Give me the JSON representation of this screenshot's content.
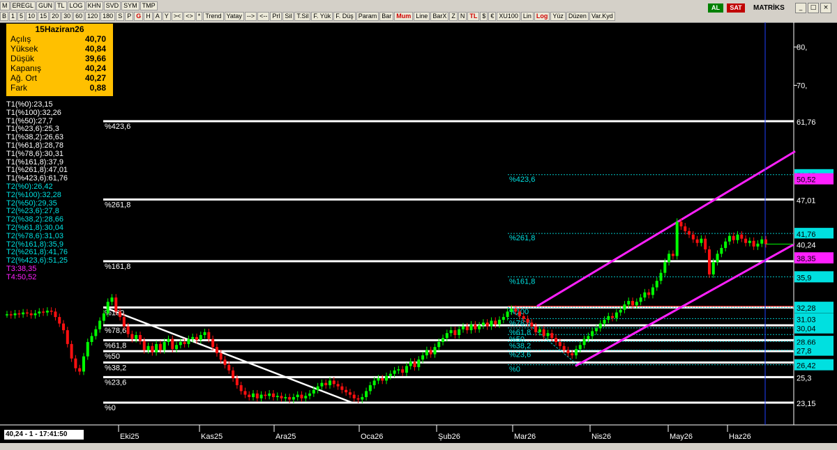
{
  "toolbar": {
    "row1": [
      "M",
      "EREGL",
      "GUN",
      "TL",
      "LOG",
      "KHN",
      "SVD",
      "SYM",
      "TMP"
    ],
    "row2": [
      "B",
      "1",
      "5",
      "10",
      "15",
      "20",
      "30",
      "60",
      "120",
      "180",
      "S",
      "P",
      "G",
      "H",
      "A",
      "Y",
      "><",
      "<>",
      "*",
      "Trend",
      "Yatay",
      "-->",
      "<--",
      "Prl",
      "Sil",
      "T.Sil",
      "F. Yük",
      "F. Düş",
      "Param",
      "Bar",
      "Mum",
      "Line",
      "BarX",
      "Z",
      "N",
      "TL",
      "$",
      "€",
      "XU100",
      "Lin",
      "Log",
      "Yüz",
      "Düzen",
      "Var.Kyd"
    ],
    "al": "AL",
    "sat": "SAT",
    "brand": "MATRİKS"
  },
  "info": {
    "date": "15Haziran26",
    "rows": [
      {
        "k": "Açılış",
        "v": "40,70"
      },
      {
        "k": "Yüksek",
        "v": "40,84"
      },
      {
        "k": "Düşük",
        "v": "39,66"
      },
      {
        "k": "Kapanış",
        "v": "40,24"
      },
      {
        "k": "Ağ. Ort",
        "v": "40,27"
      },
      {
        "k": "Fark",
        "v": "0,88"
      }
    ]
  },
  "levels": [
    {
      "t": "T1(%0):23,15",
      "c": "#ffffff"
    },
    {
      "t": "T1(%100):32,26",
      "c": "#ffffff"
    },
    {
      "t": "T1(%50):27,7",
      "c": "#ffffff"
    },
    {
      "t": "T1(%23,6):25,3",
      "c": "#ffffff"
    },
    {
      "t": "T1(%38,2):26,63",
      "c": "#ffffff"
    },
    {
      "t": "T1(%61,8):28,78",
      "c": "#ffffff"
    },
    {
      "t": "T1(%78,6):30,31",
      "c": "#ffffff"
    },
    {
      "t": "T1(%161,8):37,9",
      "c": "#ffffff"
    },
    {
      "t": "T1(%261,8):47,01",
      "c": "#ffffff"
    },
    {
      "t": "T1(%423,6):61,76",
      "c": "#ffffff"
    },
    {
      "t": "T2(%0):26,42",
      "c": "#00e0e0"
    },
    {
      "t": "T2(%100):32,28",
      "c": "#00e0e0"
    },
    {
      "t": "T2(%50):29,35",
      "c": "#00e0e0"
    },
    {
      "t": "T2(%23,6):27,8",
      "c": "#00e0e0"
    },
    {
      "t": "T2(%38,2):28,66",
      "c": "#00e0e0"
    },
    {
      "t": "T2(%61,8):30,04",
      "c": "#00e0e0"
    },
    {
      "t": "T2(%78,6):31,03",
      "c": "#00e0e0"
    },
    {
      "t": "T2(%161,8):35,9",
      "c": "#00e0e0"
    },
    {
      "t": "T2(%261,8):41,76",
      "c": "#00e0e0"
    },
    {
      "t": "T2(%423,6):51,25",
      "c": "#00e0e0"
    },
    {
      "t": "T3:38,35",
      "c": "#ff20ff"
    },
    {
      "t": "T4:50,52",
      "c": "#ff20ff"
    }
  ],
  "status": "40,24 - 1 - 17:41:50",
  "chart_data": {
    "type": "candlestick",
    "y_scale": "log",
    "y_ticks": [
      80,
      70
    ],
    "months": [
      "Eki25",
      "Kas25",
      "Ara25",
      "Oca26",
      "Şub26",
      "Mar26",
      "Nis26",
      "May26",
      "Haz26"
    ],
    "fib_t1": [
      {
        "label": "%423,6",
        "value": 61.76,
        "tag": "61,76"
      },
      {
        "label": "%261,8",
        "value": 47.01,
        "tag": "47,01"
      },
      {
        "label": "%161,8",
        "value": 37.9,
        "tag": ""
      },
      {
        "label": "%100",
        "value": 32.26,
        "tag": "32,28"
      },
      {
        "label": "%78,6",
        "value": 30.31,
        "tag": "31,03"
      },
      {
        "label": "%61,8",
        "value": 28.78,
        "tag": ""
      },
      {
        "label": "%50",
        "value": 27.7,
        "tag": ""
      },
      {
        "label": "%38,2",
        "value": 26.63,
        "tag": ""
      },
      {
        "label": "%23,6",
        "value": 25.3,
        "tag": "25,3"
      },
      {
        "label": "%0",
        "value": 23.15,
        "tag": "23,15"
      }
    ],
    "fib_t2": [
      {
        "label": "%423,6",
        "value": 51.25
      },
      {
        "label": "%261,8",
        "value": 41.76
      },
      {
        "label": "%161,8",
        "value": 35.9
      },
      {
        "label": "%100",
        "value": 32.28
      },
      {
        "label": "%78,6",
        "value": 31.03
      },
      {
        "label": "%61,8",
        "value": 30.04
      },
      {
        "label": "%50",
        "value": 29.35
      },
      {
        "label": "%38,2",
        "value": 28.66
      },
      {
        "label": "%23,6",
        "value": 27.8
      },
      {
        "label": "%0",
        "value": 26.42
      }
    ],
    "tags": {
      "t2_top": "51,25",
      "t4": "50,52",
      "t2_261": "41,76",
      "last": "40,24",
      "t3": "38,35",
      "t2_161": "35,9",
      "t2_100": "32,28",
      "t2_786": "31,03",
      "t2_618": "30,04",
      "t2_382": "28,66",
      "t2_236": "27,8",
      "t2_0": "26,42"
    },
    "closes": [
      31.5,
      31.4,
      31.6,
      31.5,
      31.7,
      31.6,
      31.4,
      31.6,
      31.8,
      31.7,
      31.9,
      31.8,
      31.2,
      30.5,
      29.8,
      28.4,
      27.0,
      26.1,
      25.8,
      27.2,
      28.6,
      29.2,
      29.9,
      30.8,
      31.6,
      32.9,
      33.4,
      31.8,
      31.2,
      30.2,
      29.4,
      28.9,
      29.3,
      28.7,
      27.8,
      28.2,
      27.6,
      28.4,
      27.8,
      28.6,
      28.9,
      27.9,
      28.3,
      28.6,
      28.4,
      28.9,
      29.1,
      28.8,
      29.3,
      29.6,
      28.9,
      28.1,
      27.5,
      26.9,
      26.4,
      25.9,
      25.2,
      24.6,
      24.1,
      23.8,
      23.6,
      23.9,
      23.5,
      23.8,
      23.7,
      23.9,
      23.6,
      23.7,
      23.5,
      23.6,
      23.4,
      23.6,
      23.8,
      23.5,
      23.7,
      23.9,
      24.2,
      24.5,
      24.8,
      24.6,
      25.0,
      24.7,
      24.5,
      24.2,
      24.0,
      23.8,
      23.5,
      23.4,
      23.6,
      24.1,
      24.6,
      25.0,
      25.2,
      25.0,
      25.4,
      25.6,
      25.9,
      26.0,
      25.7,
      26.3,
      26.7,
      26.2,
      26.9,
      27.3,
      27.8,
      27.4,
      28.1,
      28.6,
      29.0,
      29.5,
      29.8,
      29.3,
      29.9,
      30.2,
      29.8,
      30.4,
      29.9,
      30.3,
      30.6,
      30.2,
      30.8,
      30.4,
      30.9,
      31.2,
      31.8,
      32.1,
      31.8,
      31.3,
      31.0,
      30.6,
      30.2,
      29.6,
      29.9,
      29.2,
      29.5,
      29.0,
      28.6,
      28.2,
      27.8,
      27.5,
      27.3,
      27.9,
      28.3,
      28.9,
      29.2,
      29.7,
      30.0,
      30.5,
      30.9,
      31.3,
      31.1,
      31.7,
      32.0,
      32.6,
      33.0,
      32.5,
      32.9,
      33.4,
      34.0,
      33.7,
      34.6,
      35.4,
      36.4,
      37.8,
      38.9,
      38.6,
      43.5,
      42.8,
      42.1,
      41.6,
      40.9,
      40.4,
      41.0,
      39.5,
      36.2,
      37.8,
      38.9,
      39.7,
      40.6,
      41.4,
      40.8,
      41.6,
      41.0,
      40.4,
      40.7,
      39.9,
      40.3,
      40.9,
      40.24
    ]
  }
}
